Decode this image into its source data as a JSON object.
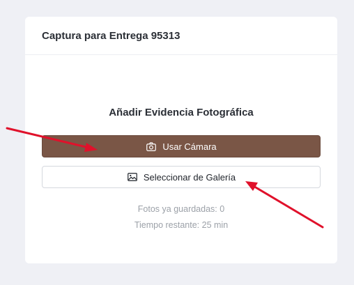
{
  "card": {
    "title": "Captura para Entrega 95313",
    "section_heading": "Añadir Evidencia Fotográfica",
    "camera_button": {
      "label": "Usar Cámara",
      "icon": "camera-icon"
    },
    "gallery_button": {
      "label": "Seleccionar de Galería",
      "icon": "image-icon"
    },
    "saved_photos": "Fotos ya guardadas: 0",
    "time_remaining": "Tiempo restante: 25 min"
  },
  "colors": {
    "background": "#eff0f5",
    "primary_button": "#7a5646",
    "annotation_arrow": "#e0112b"
  }
}
